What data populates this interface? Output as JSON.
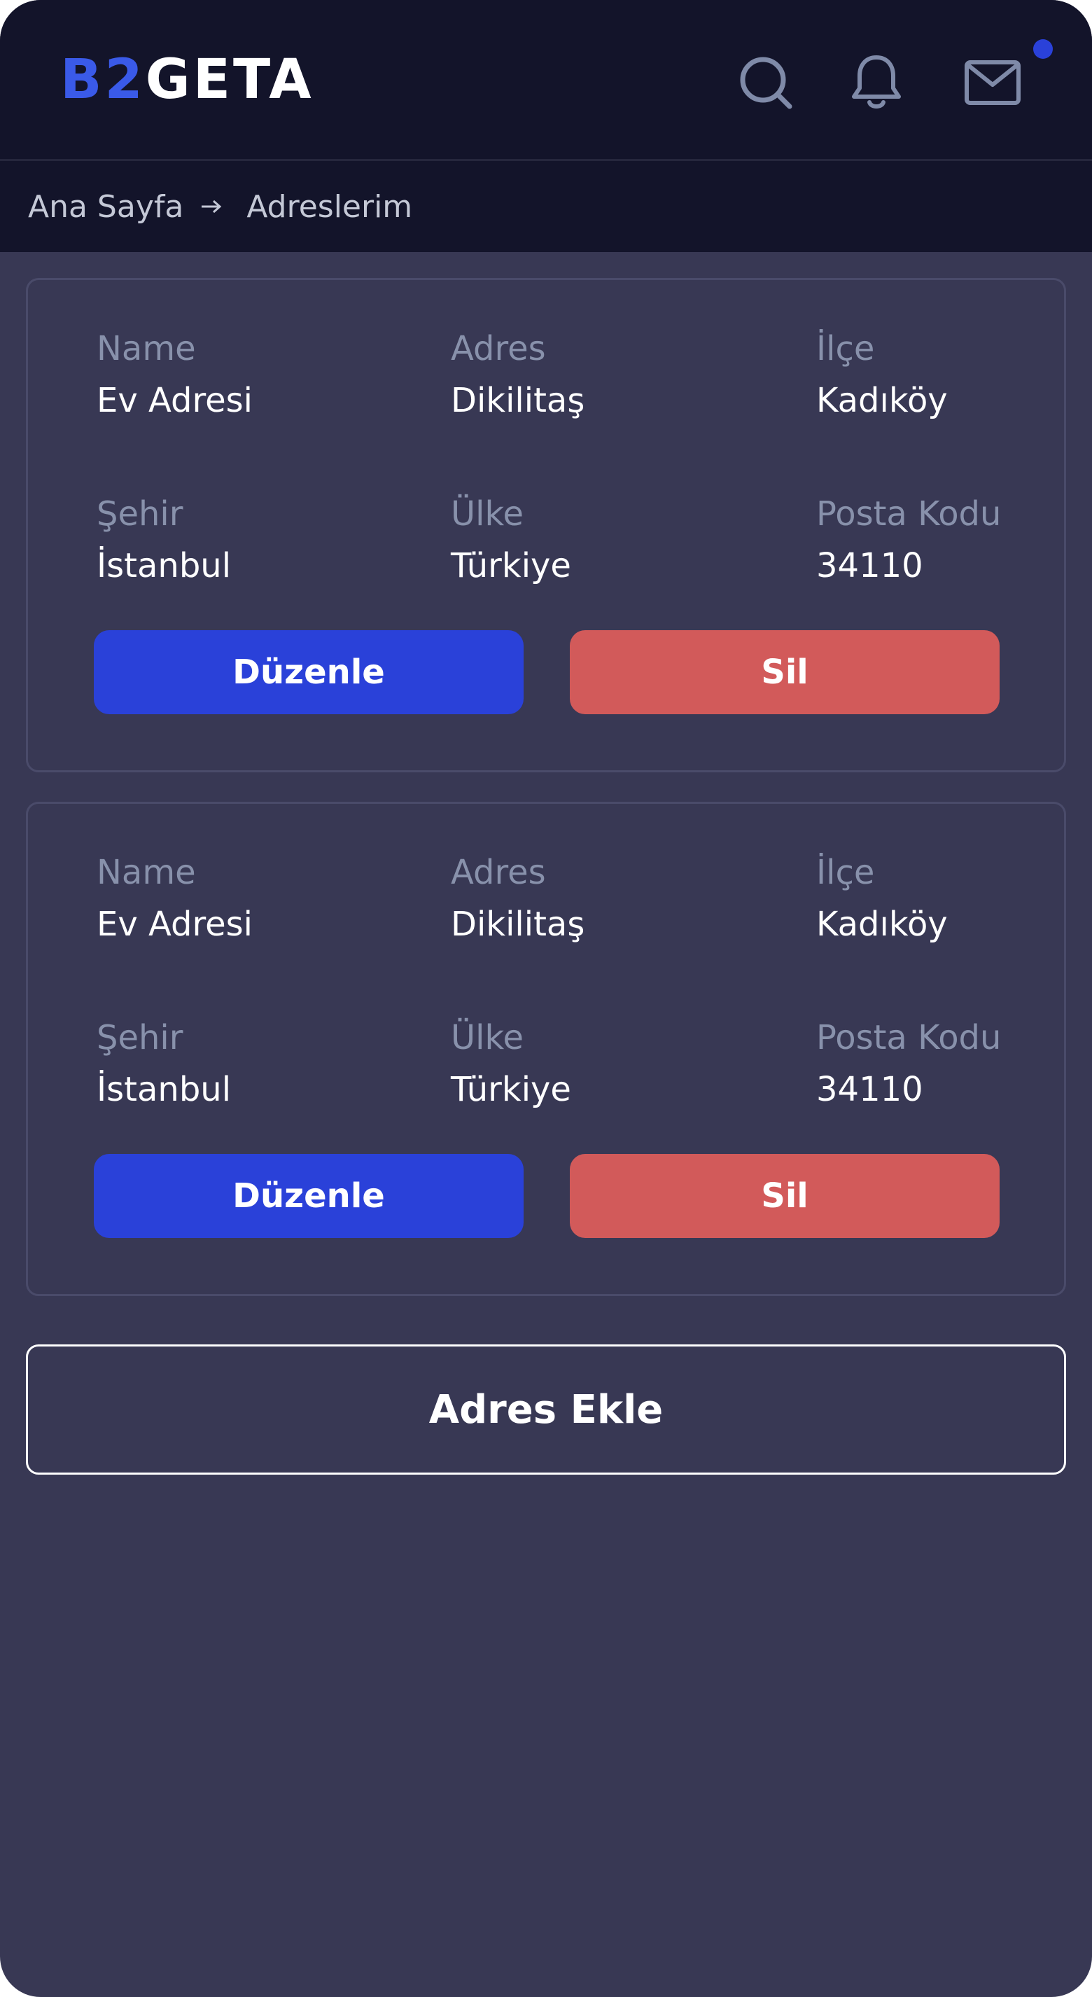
{
  "header": {
    "logo_part1": "B2",
    "logo_part2": "GETA",
    "colors": {
      "bar": "#13142a",
      "icon": "#7f8aa8",
      "notification_dot": "#2a41d9",
      "logo_accent": "#3a5ae8"
    },
    "icons": [
      "search-icon",
      "bell-icon",
      "mail-icon"
    ],
    "has_notification": true
  },
  "breadcrumb": {
    "home": "Ana Sayfa",
    "current": "Adreslerim"
  },
  "labels": {
    "name": "Name",
    "adres": "Adres",
    "ilce": "İlçe",
    "sehir": "Şehir",
    "ulke": "Ülke",
    "posta_kodu": "Posta Kodu"
  },
  "addresses": [
    {
      "name": "Ev Adresi",
      "adres": "Dikilitaş",
      "ilce": "Kadıköy",
      "sehir": "İstanbul",
      "ulke": "Türkiye",
      "posta_kodu": "34110",
      "edit_label": "Düzenle",
      "delete_label": "Sil"
    },
    {
      "name": "Ev Adresi",
      "adres": "Dikilitaş",
      "ilce": "Kadıköy",
      "sehir": "İstanbul",
      "ulke": "Türkiye",
      "posta_kodu": "34110",
      "edit_label": "Düzenle",
      "delete_label": "Sil"
    }
  ],
  "actions": {
    "add_address": "Adres Ekle"
  },
  "theme": {
    "background": "#383854",
    "edit_button": "#2a41d9",
    "delete_button": "#d25a5a",
    "label_text": "#8891ab",
    "value_text": "#ffffff"
  }
}
